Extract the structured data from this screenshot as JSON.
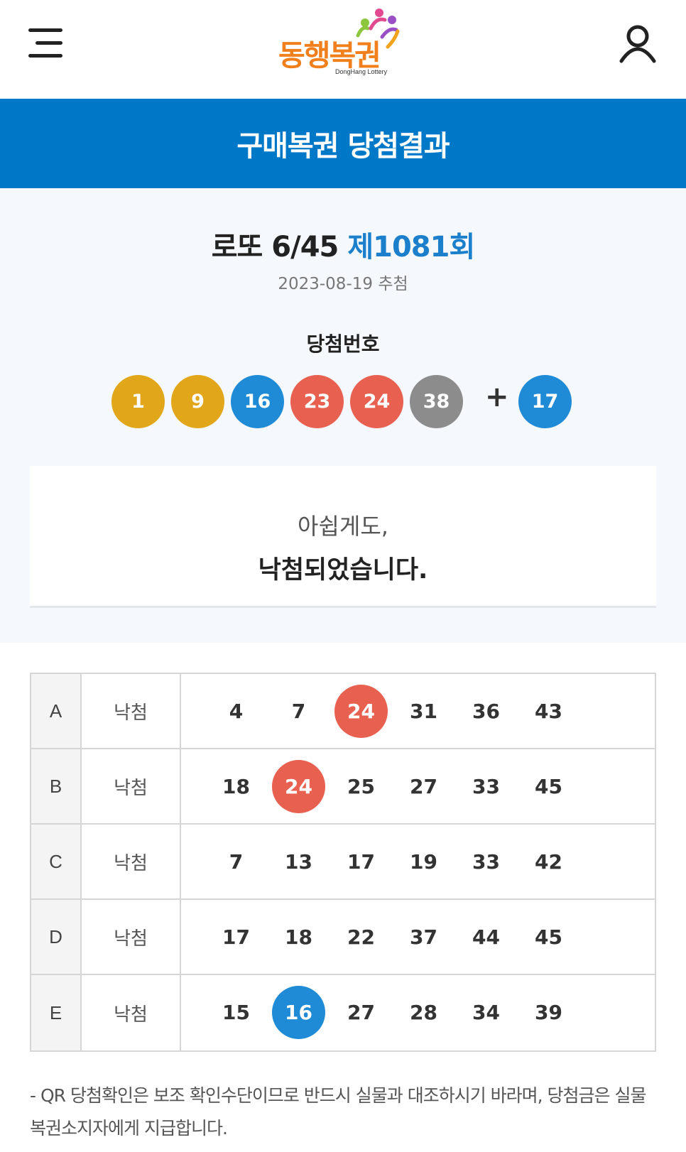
{
  "header": {
    "logo_text": "동행복권",
    "logo_sub": "DongHang Lottery"
  },
  "page_title": "구매복권 당첨결과",
  "result": {
    "game_name": "로또 6/45",
    "round": "제1081회",
    "draw_date": "2023-08-19 추첨",
    "winning_label": "당첨번호",
    "winning_numbers": [
      {
        "value": "1",
        "color": "#e2a61b"
      },
      {
        "value": "9",
        "color": "#e2a61b"
      },
      {
        "value": "16",
        "color": "#1f8ad6"
      },
      {
        "value": "23",
        "color": "#e8604f"
      },
      {
        "value": "24",
        "color": "#e8604f"
      },
      {
        "value": "38",
        "color": "#8c8c8c"
      }
    ],
    "plus": "+",
    "bonus_number": {
      "value": "17",
      "color": "#1f8ad6"
    },
    "notice_line1": "아쉽게도,",
    "notice_line2": "낙첨되었습니다."
  },
  "tickets": [
    {
      "letter": "A",
      "status": "낙첨",
      "numbers": [
        {
          "value": "4"
        },
        {
          "value": "7"
        },
        {
          "value": "24",
          "hit_color": "#e8604f"
        },
        {
          "value": "31"
        },
        {
          "value": "36"
        },
        {
          "value": "43"
        }
      ]
    },
    {
      "letter": "B",
      "status": "낙첨",
      "numbers": [
        {
          "value": "18"
        },
        {
          "value": "24",
          "hit_color": "#e8604f"
        },
        {
          "value": "25"
        },
        {
          "value": "27"
        },
        {
          "value": "33"
        },
        {
          "value": "45"
        }
      ]
    },
    {
      "letter": "C",
      "status": "낙첨",
      "numbers": [
        {
          "value": "7"
        },
        {
          "value": "13"
        },
        {
          "value": "17"
        },
        {
          "value": "19"
        },
        {
          "value": "33"
        },
        {
          "value": "42"
        }
      ]
    },
    {
      "letter": "D",
      "status": "낙첨",
      "numbers": [
        {
          "value": "17"
        },
        {
          "value": "18"
        },
        {
          "value": "22"
        },
        {
          "value": "37"
        },
        {
          "value": "44"
        },
        {
          "value": "45"
        }
      ]
    },
    {
      "letter": "E",
      "status": "낙첨",
      "numbers": [
        {
          "value": "15"
        },
        {
          "value": "16",
          "hit_color": "#1f8ad6"
        },
        {
          "value": "27"
        },
        {
          "value": "28"
        },
        {
          "value": "34"
        },
        {
          "value": "39"
        }
      ]
    }
  ],
  "footnote": "- QR 당첨확인은 보조 확인수단이므로 반드시 실물과 대조하시기 바라며, 당첨금은 실물 복권소지자에게 지급합니다.",
  "icons": {
    "menu": "hamburger-menu-icon",
    "user": "user-icon"
  }
}
